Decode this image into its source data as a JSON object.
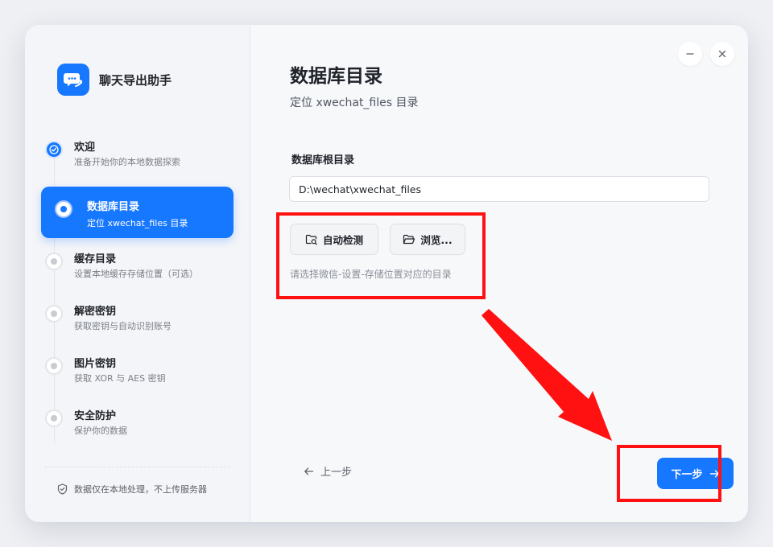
{
  "app": {
    "name": "聊天导出助手"
  },
  "steps": [
    {
      "title": "欢迎",
      "subtitle": "准备开始你的本地数据探索",
      "status": "done"
    },
    {
      "title": "数据库目录",
      "subtitle": "定位 xwechat_files 目录",
      "status": "active"
    },
    {
      "title": "缓存目录",
      "subtitle": "设置本地缓存存储位置（可选）",
      "status": "pending"
    },
    {
      "title": "解密密钥",
      "subtitle": "获取密钥与自动识别账号",
      "status": "pending"
    },
    {
      "title": "图片密钥",
      "subtitle": "获取 XOR 与 AES 密钥",
      "status": "pending"
    },
    {
      "title": "安全防护",
      "subtitle": "保护你的数据",
      "status": "pending"
    }
  ],
  "footer": {
    "privacy_text": "数据仅在本地处理，不上传服务器"
  },
  "main": {
    "title": "数据库目录",
    "subtitle": "定位 xwechat_files 目录",
    "field_label": "数据库根目录",
    "path_value": "D:\\wechat\\xwechat_files",
    "auto_detect_label": "自动检测",
    "browse_label": "浏览...",
    "hint": "请选择微信-设置-存储位置对应的目录",
    "prev_label": "上一步",
    "next_label": "下一步"
  },
  "colors": {
    "accent": "#1677ff",
    "annotation": "#ff1111"
  },
  "icons": [
    "chat-bubble-logo-icon",
    "check-icon",
    "shield-icon",
    "minimize-icon",
    "close-icon",
    "folder-search-icon",
    "folder-open-icon",
    "arrow-left-icon",
    "arrow-right-icon"
  ]
}
